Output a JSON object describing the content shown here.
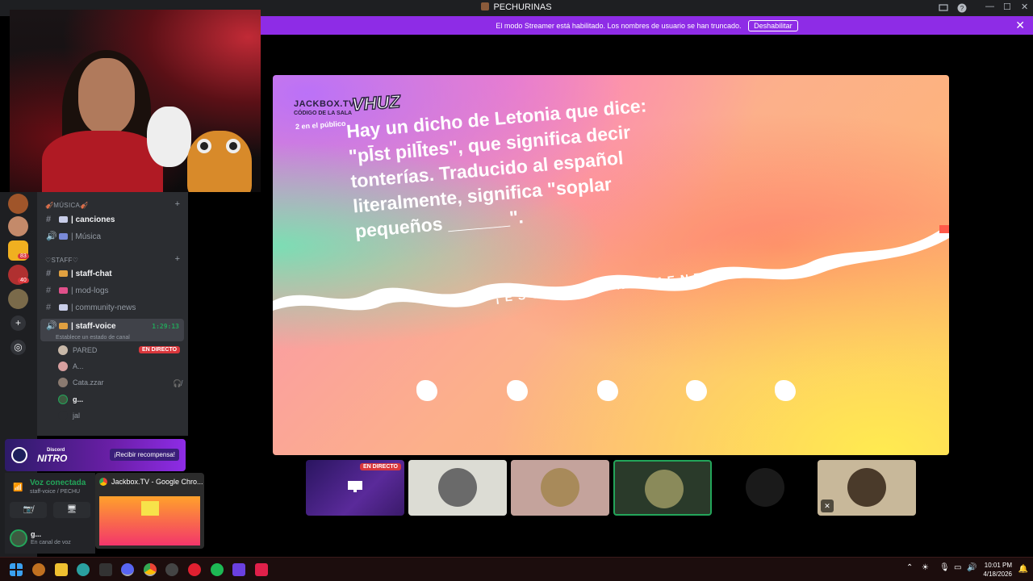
{
  "window": {
    "title": "PECHURINAS",
    "controls": [
      "—",
      "☐",
      "✕"
    ]
  },
  "streamer": {
    "message": "El modo Streamer está habilitado. Los nombres de usuario se han truncado.",
    "button": "Deshabilitar",
    "close": "✕"
  },
  "rail": {
    "badges": [
      "83",
      "40"
    ],
    "add": "+",
    "explore": "◎"
  },
  "categories": {
    "musica": "🎻MÚSICA🎻",
    "staff": "♡STAFF♡"
  },
  "channels": {
    "canciones": "| canciones",
    "musica": "| Música",
    "staff_chat": "| staff-chat",
    "mod_logs": "| mod-logs",
    "community_news": "| community-news",
    "staff_voice": "| staff-voice",
    "staff_voice_timer": "1:29:13",
    "staff_voice_status": "Establece un estado de canal"
  },
  "voice_users": [
    {
      "name": "PARED",
      "live": "EN DIRECTO"
    },
    {
      "name": "A..."
    },
    {
      "name": "Cata.zzar"
    },
    {
      "name": "g..."
    },
    {
      "name": "jal"
    }
  ],
  "nitro": {
    "small": "Discord",
    "big": "NITRO",
    "claim": "¡Recibir recompensa!"
  },
  "voice_panel": {
    "status": "Voz conectada",
    "channel": "staff-voice / PECHU",
    "user": "g...",
    "user_status": "En canal de voz"
  },
  "thumbnail": {
    "title": "Jackbox.TV - Google Chro..."
  },
  "game": {
    "brand": "JACKBOX.TV",
    "room_label": "CÓDIGO DE LA SALA",
    "room_code": "VHUZ",
    "audience": "2 en el público",
    "prompt": "Hay un dicho de Letonia que dice: \"pĪst pilĪtes\", que significa decir tonterías. Traducido al español literalmente, significa \"soplar pequeños ______\".",
    "cta": "¡ESCRIBE UNA MENTIRA!"
  },
  "tiles": {
    "live": "EN DIRECTO"
  },
  "taskbar": {
    "time": "10:01 PM",
    "date": "4/18/2026"
  },
  "colors": {
    "accent": "#8e2ce6",
    "live": "#da373c",
    "connected": "#23a55a"
  }
}
